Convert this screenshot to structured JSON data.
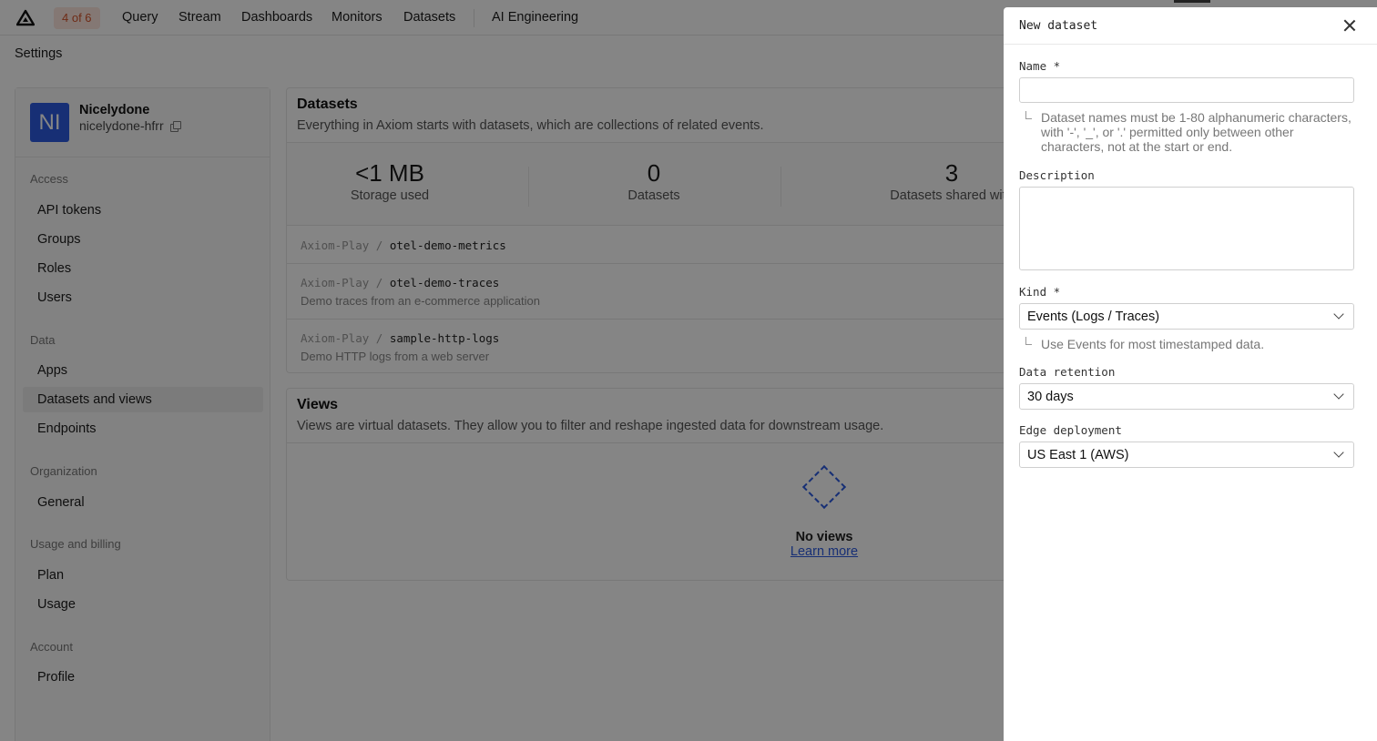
{
  "nav": {
    "counter": "4 of 6",
    "links": [
      "Query",
      "Stream",
      "Dashboards",
      "Monitors",
      "Datasets",
      "AI Engineering"
    ]
  },
  "breadcrumb": "Settings",
  "org": {
    "initials": "NI",
    "name": "Nicelydone",
    "slug": "nicelydone-hfrr"
  },
  "sidebar": {
    "sections": [
      {
        "label": "Access",
        "items": [
          "API tokens",
          "Groups",
          "Roles",
          "Users"
        ]
      },
      {
        "label": "Data",
        "items": [
          "Apps",
          "Datasets and views",
          "Endpoints"
        ]
      },
      {
        "label": "Organization",
        "items": [
          "General"
        ]
      },
      {
        "label": "Usage and billing",
        "items": [
          "Plan",
          "Usage"
        ]
      },
      {
        "label": "Account",
        "items": [
          "Profile"
        ]
      }
    ],
    "active": "Datasets and views"
  },
  "datasets_card": {
    "title": "Datasets",
    "description": "Everything in Axiom starts with datasets, which are collections of related events.",
    "stats": [
      {
        "value": "<1 MB",
        "label": "Storage used"
      },
      {
        "value": "0",
        "label": "Datasets"
      },
      {
        "value": "3",
        "label": "Datasets shared with"
      }
    ],
    "rows": [
      {
        "org": "Axiom-Play",
        "sep": "/",
        "name": "otel-demo-metrics",
        "desc": ""
      },
      {
        "org": "Axiom-Play",
        "sep": "/",
        "name": "otel-demo-traces",
        "desc": "Demo traces from an e-commerce application"
      },
      {
        "org": "Axiom-Play",
        "sep": "/",
        "name": "sample-http-logs",
        "desc": "Demo HTTP logs from a web server"
      }
    ]
  },
  "views_card": {
    "title": "Views",
    "description": "Views are virtual datasets. They allow you to filter and reshape ingested data for downstream usage.",
    "empty_title": "No views",
    "empty_link": "Learn more"
  },
  "drawer": {
    "title": "New dataset",
    "name_label": "Name *",
    "name_value": "",
    "name_hint": "Dataset names must be 1-80 alphanumeric characters, with '-', '_', or '.' permitted only between other characters, not at the start or end.",
    "description_label": "Description",
    "description_value": "",
    "kind_label": "Kind *",
    "kind_value": "Events (Logs / Traces)",
    "kind_hint": "Use Events for most timestamped data.",
    "retention_label": "Data retention",
    "retention_value": "30 days",
    "edge_label": "Edge deployment",
    "edge_value": "US East 1 (AWS)"
  },
  "colors": {
    "accent": "#2c5be0",
    "counter_bg": "#fde7de",
    "counter_text": "#d4532b",
    "overlay": "rgba(0,0,0,0.48)"
  }
}
